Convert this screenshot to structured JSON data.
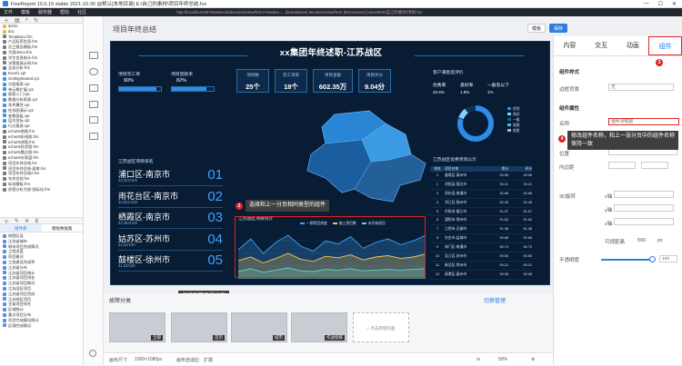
{
  "window": {
    "title": "FineReport 10.0.19 stable 2021-10-30 @默认[本地目录]   E:\\自己的素材\\项目年终总结.fvs"
  },
  "menu": {
    "items": [
      "文件",
      "模板",
      "服务器",
      "帮助",
      "社区"
    ],
    "address": "http://localhost:8075/webroot/decision/view/form?viewlet=...  [standalone]  decision/view/form  [Reconnect]  \\reportlets\\自己的素材\\项目.fvs"
  },
  "left_panel": {
    "files": [
      "demo",
      "doc",
      "Template1.frm",
      "产品标签信息.frm",
      "员工报告模板.frm",
      "大屏demo.frm",
      "学生信息统计.frm",
      "决策报表示例.frm",
      "业务分析.frm",
      "Excel1.cpt",
      "GettingStarted.cpt",
      "分组报表.cpt",
      "单元格扩展.cpt",
      "图表入门.cpt",
      "数据分析报表.cpt",
      "条件属性.cpt",
      "柱形图演示.cpt",
      "参数面板.cpt",
      "层次坐标.cpt",
      "行式报表.cpt",
      "echarts地图.frm",
      "echarts折线图.frm",
      "echarts饼图.frm",
      "echarts柱状图.frm",
      "echarts雷达图.frm",
      "echarts仪表盘.frm",
      "项目年终总结.fvs",
      "项目年终总结-副本.fvs",
      "项目年终总结2.fvs",
      "年终总结.fvs",
      "标准模板.frm",
      "经营分析大屏-国际化.frm"
    ],
    "tab_left": "组件库",
    "tab_right": "模板数据集",
    "components": [
      "地图区县",
      "江苏省城市",
      "城市项目完成情况",
      "工程进度",
      "项目概况",
      "工程建设完成率",
      "江苏省分布",
      "江苏省项目统计",
      "江苏省项目排名",
      "江苏省项目概况",
      "江苏战区项目",
      "江苏省项目完成",
      "江苏地区项目",
      "全省项目排名",
      "区域统计",
      "重点项目分布",
      "项目完成情况统计",
      "区域完成情况"
    ]
  },
  "canvas": {
    "page_title": "项目年终总结",
    "btn_settings": "模板",
    "btn_save": "保存"
  },
  "dashboard": {
    "title": "xx集团年终述职-江苏战区",
    "left_section": "项目完工率",
    "left_section2": "项目回款率",
    "pct1": "90%",
    "pct2": "82%",
    "kpis": [
      {
        "label": "项目数",
        "value": "25个"
      },
      {
        "label": "完工项目",
        "value": "18个"
      },
      {
        "label": "项目金额",
        "value": "602.35万"
      },
      {
        "label": "项目评分",
        "value": "9.04分"
      }
    ],
    "city_section": "江苏战区项目排名",
    "cities": [
      {
        "name": "浦口区-南京市",
        "value": "33,522/100",
        "rank": "01"
      },
      {
        "name": "雨花台区-南京市",
        "value": "32,821/100",
        "rank": "02"
      },
      {
        "name": "栖霞区-南京市",
        "value": "32,353/100",
        "rank": "03"
      },
      {
        "name": "姑苏区-苏州市",
        "value": "32,54/100",
        "rank": "04"
      },
      {
        "name": "鼓楼区-徐州市",
        "value": "31,53/100",
        "rank": "05"
      }
    ],
    "right_section": "客户满意度评价",
    "sat_labels": [
      "优秀率",
      "良好率",
      "一般及以下"
    ],
    "sat_values": [
      "32.6%",
      "1.9%",
      "1%"
    ],
    "legend": [
      "优秀",
      "良好",
      "一般",
      "较差",
      "很差"
    ],
    "table_section": "江苏战区优秀项目公示",
    "table_head": [
      "排名",
      "项目名称",
      "得分",
      "评分"
    ],
    "table_rows": [
      [
        "1",
        "姜堰区-泰州市",
        "93.56",
        "93.56"
      ],
      [
        "2",
        "沭阳县-宿迁市",
        "93.21",
        "93.21"
      ],
      [
        "3",
        "如东县-南通市",
        "92.68",
        "92.68"
      ],
      [
        "4",
        "邗江区-扬州市",
        "92.45",
        "92.45"
      ],
      [
        "5",
        "丹阳市-镇江市",
        "91.97",
        "91.97"
      ],
      [
        "6",
        "溧阳市-常州市",
        "91.62",
        "91.62"
      ],
      [
        "7",
        "江阴市-无锡市",
        "91.38",
        "91.38"
      ],
      [
        "8",
        "东台市-盐城市",
        "90.88",
        "90.88"
      ],
      [
        "9",
        "海门区-南通市",
        "90.73",
        "90.73"
      ],
      [
        "10",
        "吴江区-苏州市",
        "90.55",
        "90.55"
      ],
      [
        "11",
        "新北区-常州市",
        "90.21",
        "90.21"
      ],
      [
        "12",
        "高港区-泰州市",
        "90.08",
        "90.08"
      ]
    ],
    "chart_title": "江苏战区项目统计",
    "chart_legend": [
      "一期项目进度",
      "施工项目数",
      "未开始项目"
    ]
  },
  "annotations": [
    {
      "num": "1",
      "text": "切换到第二张分页"
    },
    {
      "num": "2",
      "text": "选择和上一分页相同类型的组件"
    },
    {
      "num": "3",
      "text": ""
    },
    {
      "num": "4",
      "text": "修改组件名称，和上一张分页中的组件名称保持一致"
    }
  ],
  "right_panel": {
    "tabs": [
      "内容",
      "交互",
      "动画",
      "组件"
    ],
    "section1": "组件样式",
    "bg_label": "边框背景",
    "bg_value": "无",
    "section2": "组件属性",
    "name_label": "名称",
    "name_value": "组件对照图",
    "pos_label": "位置",
    "inner_label": "内边距",
    "rotate_label": "3D旋转",
    "x_label": "x轴",
    "y_label": "y轴",
    "z_label": "z轴",
    "view_label": "可视距离",
    "view_value": "500",
    "opacity_label": "不透明度",
    "opacity_value": "100",
    "unit": "px"
  },
  "pages": {
    "label": "故障分类",
    "manage": "切换管理",
    "thumbs": [
      "全部",
      "首页",
      "城市",
      "作战指挥"
    ],
    "add": "+ 点击新增页面",
    "size_label": "画布尺寸",
    "size_value": "1000×1080px",
    "fit_label": "画布自适应",
    "fit_value": "扩展",
    "zoom": "50%"
  },
  "chart_data": {
    "type": "area",
    "title": "江苏战区项目统计",
    "series": [
      {
        "name": "一期项目进度",
        "values": [
          40,
          55,
          35,
          50,
          60,
          45,
          38,
          52,
          48,
          58,
          42,
          50,
          55,
          47,
          52,
          60
        ]
      },
      {
        "name": "施工项目数",
        "values": [
          25,
          30,
          22,
          28,
          35,
          27,
          24,
          31,
          29,
          33,
          26,
          30,
          32,
          28,
          30,
          34
        ]
      },
      {
        "name": "未开始项目",
        "values": [
          10,
          14,
          9,
          12,
          15,
          11,
          10,
          13,
          12,
          14,
          11,
          12,
          13,
          12,
          13,
          14
        ]
      }
    ],
    "ylim": [
      0,
      70
    ]
  },
  "colors": {
    "accent": "#2f7de1",
    "annotation": "#e02424",
    "dash_bg": "#081c33"
  }
}
